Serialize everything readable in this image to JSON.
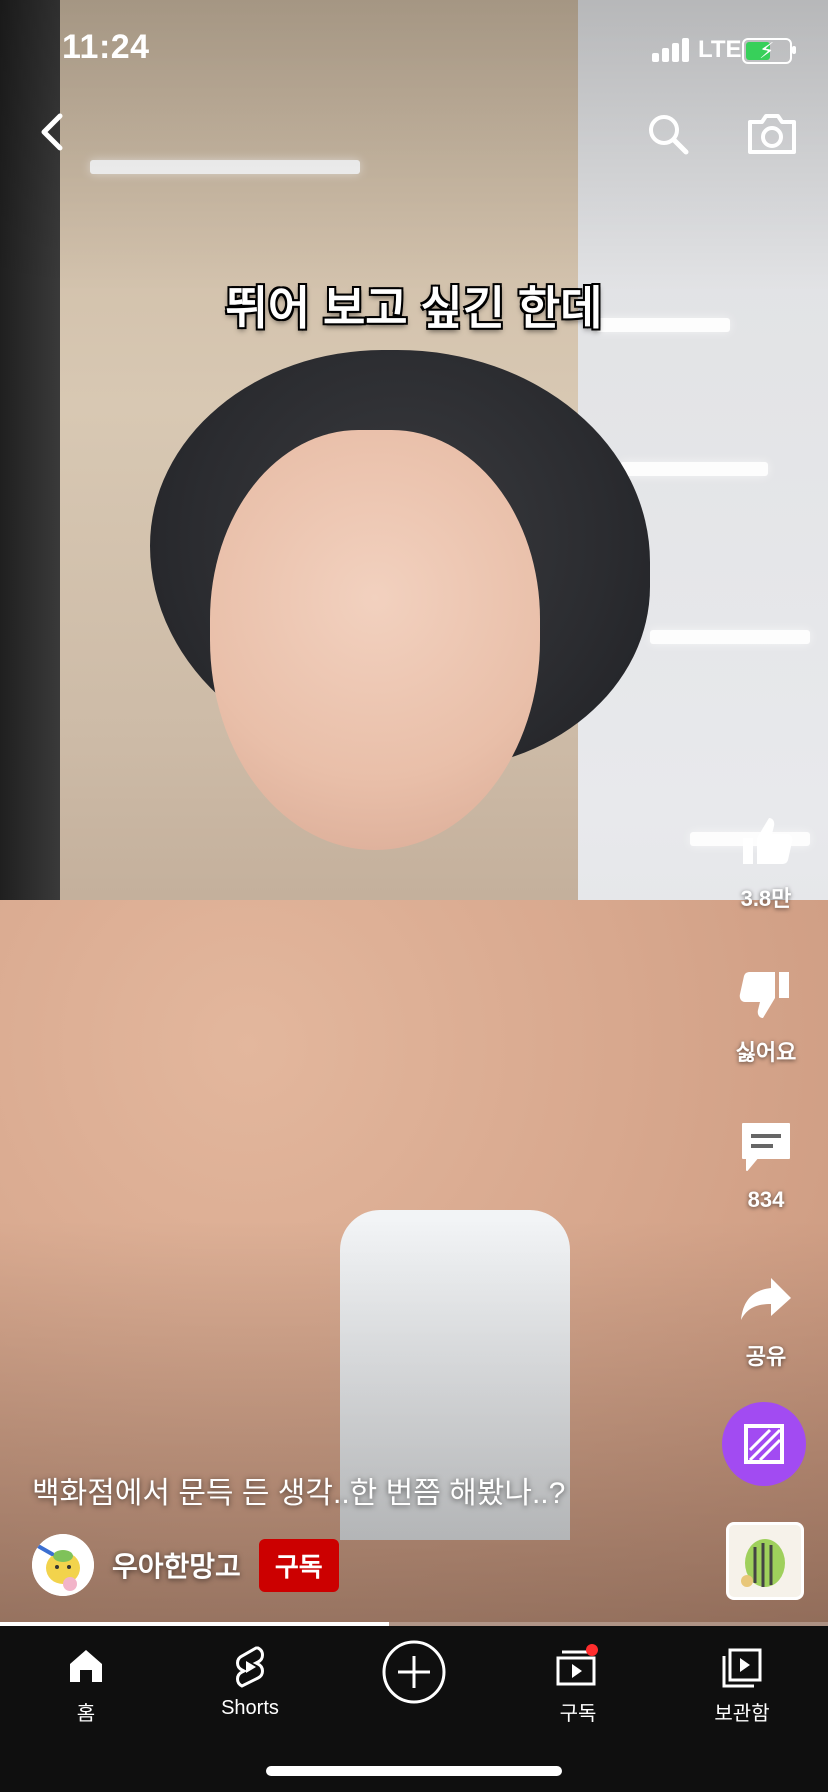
{
  "status_bar": {
    "time": "11:24",
    "network": "LTE",
    "battery_level": 0.6,
    "charging": true
  },
  "video": {
    "overlay_caption": "뛰어 보고 싶긴 한데",
    "title": "백화점에서 문득 든 생각..한 번쯤 해봤나..?",
    "progress": 0.47
  },
  "channel": {
    "name": "우아한망고",
    "subscribe_label": "구독"
  },
  "actions": {
    "like_count": "3.8만",
    "dislike_label": "싫어요",
    "comment_count": "834",
    "share_label": "공유"
  },
  "bottom_nav": {
    "items": [
      {
        "label": "홈",
        "icon": "home-icon",
        "active": true
      },
      {
        "label": "Shorts",
        "icon": "shorts-icon",
        "active": false
      },
      {
        "label": "",
        "icon": "create-plus-icon",
        "active": false
      },
      {
        "label": "구독",
        "icon": "subscriptions-icon",
        "active": false,
        "badge": true
      },
      {
        "label": "보관함",
        "icon": "library-icon",
        "active": false
      }
    ]
  },
  "colors": {
    "subscribe_red": "#cc0000",
    "remix_purple": "#a24bf2",
    "nav_background": "#0f0f0f",
    "battery_green": "#37d05a"
  }
}
